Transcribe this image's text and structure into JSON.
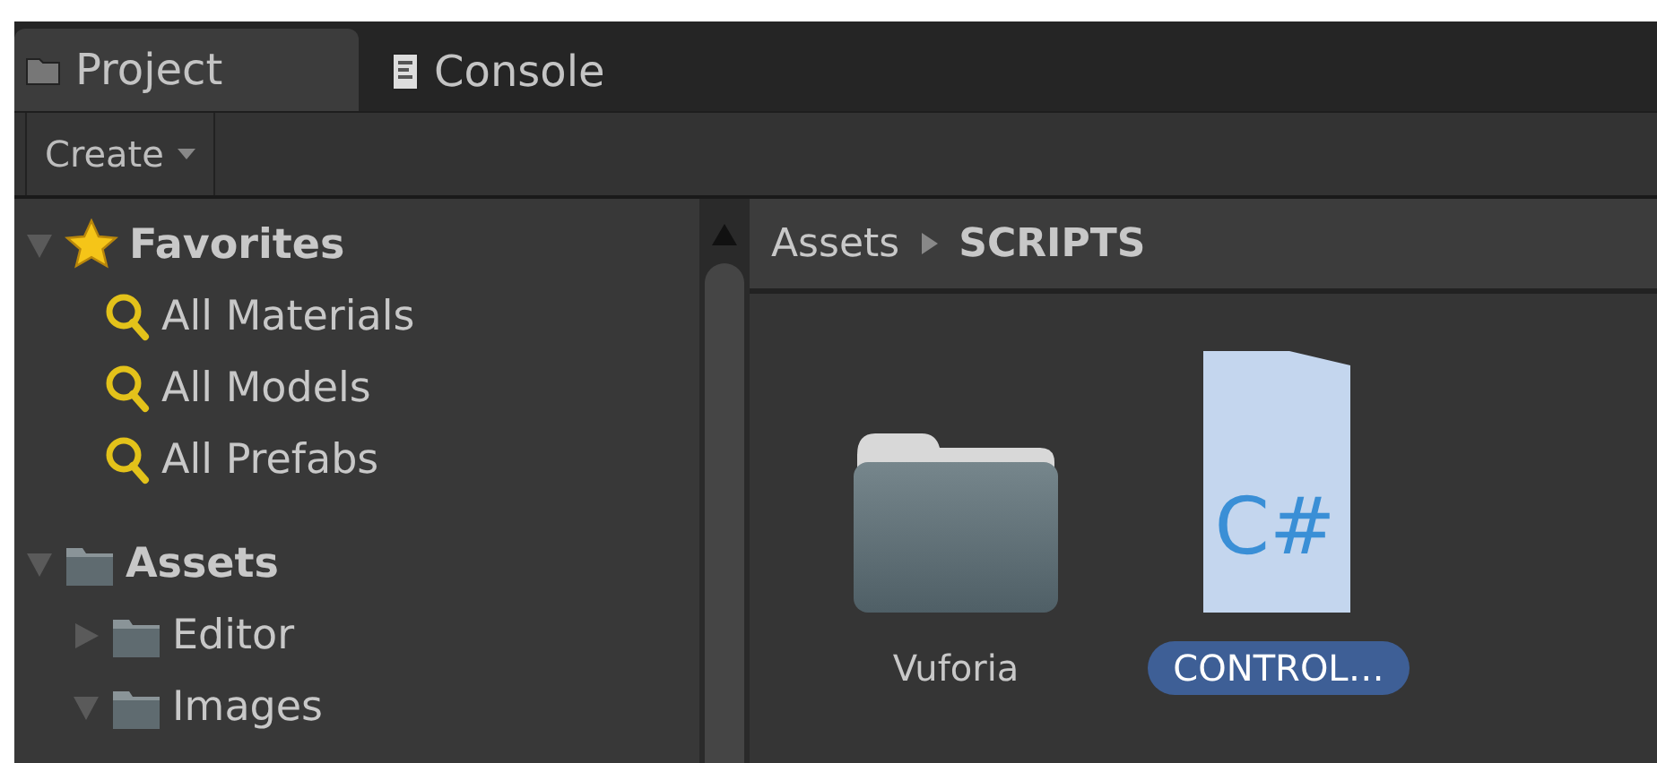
{
  "tabs": [
    {
      "label": "Project",
      "kind": "folder",
      "selected": true
    },
    {
      "label": "Console",
      "kind": "console",
      "selected": false
    }
  ],
  "toolbar": {
    "create_button": "Create"
  },
  "tree": [
    {
      "label": "Favorites",
      "kind": "favorites",
      "expanded": true,
      "children": [
        {
          "label": "All Materials",
          "kind": "search"
        },
        {
          "label": "All Models",
          "kind": "search"
        },
        {
          "label": "All Prefabs",
          "kind": "search"
        }
      ]
    },
    {
      "label": "Assets",
      "kind": "folder",
      "expanded": true,
      "children": [
        {
          "label": "Editor",
          "kind": "folder",
          "expanded": false
        },
        {
          "label": "Images",
          "kind": "folder",
          "expanded": true
        }
      ]
    }
  ],
  "breadcrumb": [
    "Assets",
    "SCRIPTS"
  ],
  "items": [
    {
      "name": "Vuforia",
      "kind": "folder",
      "selected": false
    },
    {
      "name": "CONTROL…",
      "kind": "csharp",
      "icon_text": "C#",
      "selected": true
    }
  ]
}
